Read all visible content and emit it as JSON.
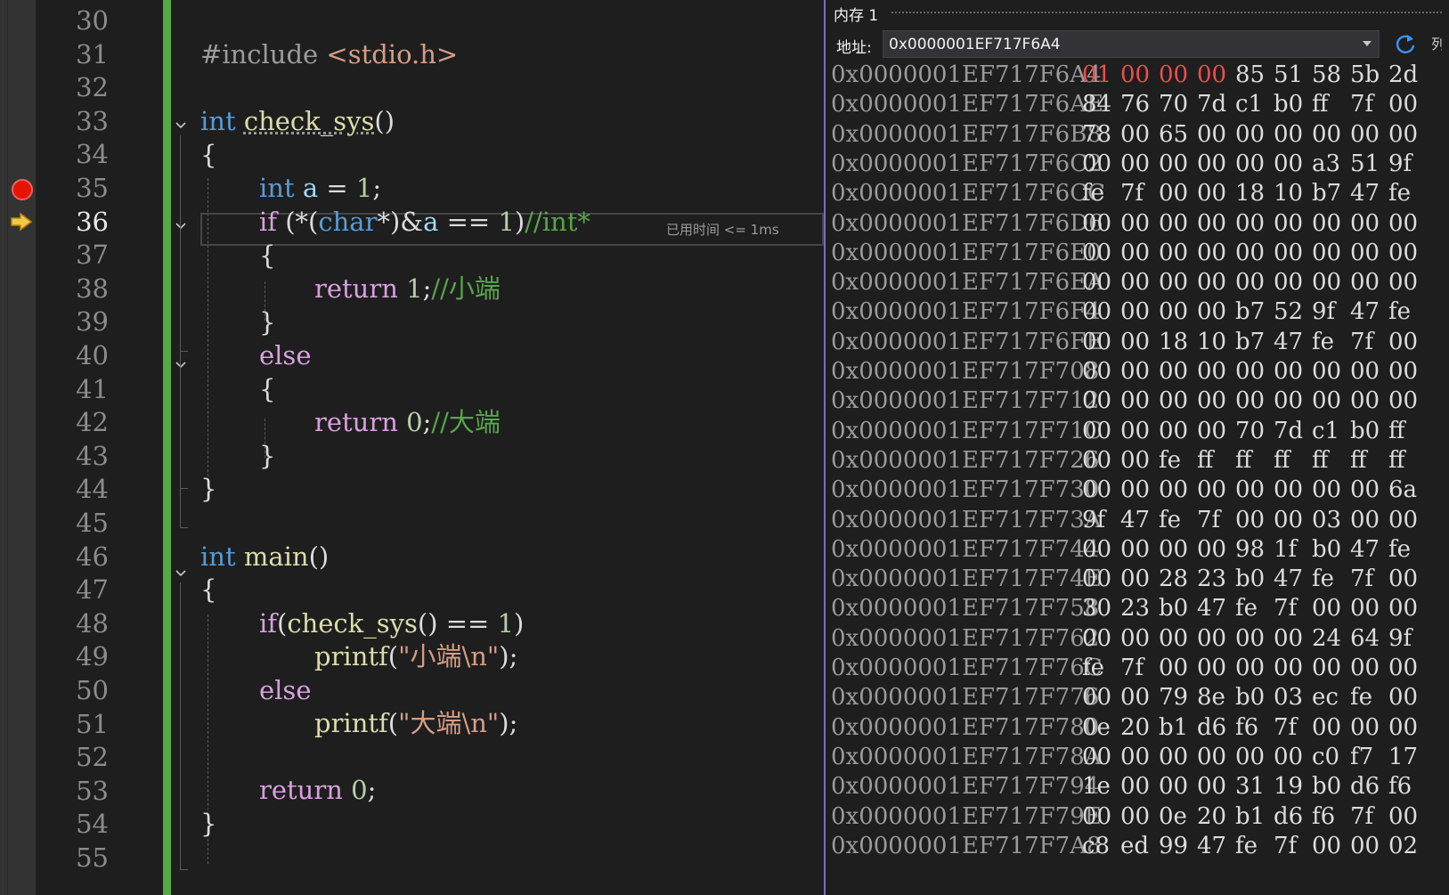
{
  "editor": {
    "line_numbers": [
      "30",
      "31",
      "32",
      "33",
      "34",
      "35",
      "36",
      "37",
      "38",
      "39",
      "40",
      "41",
      "42",
      "43",
      "44",
      "45",
      "46",
      "47",
      "48",
      "49",
      "50",
      "51",
      "52",
      "53",
      "54",
      "55"
    ],
    "current_line": "36",
    "breakpoint_line": "35",
    "elapsed_tip": "已用时间 <= 1ms",
    "code": {
      "l31_a": "#include",
      "l31_b": " <stdio.h>",
      "l33_kw": "int",
      "l33_fn": "check_sys",
      "l33_rest": "()",
      "l34": "{",
      "l35_kw": "int",
      "l35_var": "a",
      "l35_op": " = ",
      "l35_num": "1",
      "l35_end": ";",
      "l36_if": "if",
      "l36_a": " (*(",
      "l36_char": "char",
      "l36_b": "*)&",
      "l36_var": "a",
      "l36_c": " == ",
      "l36_num": "1",
      "l36_d": ")",
      "l36_cmt": "//int*",
      "l37": "{",
      "l38_ret": "return",
      "l38_num": " 1",
      "l38_end": ";",
      "l38_cmt": "//小端",
      "l39": "}",
      "l40_else": "else",
      "l41": "{",
      "l42_ret": "return",
      "l42_num": " 0",
      "l42_end": ";",
      "l42_cmt": "//大端",
      "l43": "}",
      "l44": "}",
      "l46_kw": "int",
      "l46_fn": "main",
      "l46_rest": "()",
      "l47": "{",
      "l48_if": "if",
      "l48_a": "(",
      "l48_fn": "check_sys",
      "l48_b": "() == ",
      "l48_num": "1",
      "l48_c": ")",
      "l49_fn": "printf",
      "l49_a": "(",
      "l49_str": "\"小端\\n\"",
      "l49_b": ");",
      "l50_else": "else",
      "l51_fn": "printf",
      "l51_a": "(",
      "l51_str": "\"大端\\n\"",
      "l51_b": ");",
      "l53_ret": "return",
      "l53_num": " 0",
      "l53_end": ";",
      "l54": "}"
    }
  },
  "memory": {
    "title": "内存 1",
    "address_label": "地址:",
    "address_value": "0x0000001EF717F6A4",
    "extra_button_glyph": "列",
    "rows": [
      {
        "addr": "0x0000001EF717F6A4",
        "bytes": [
          "01",
          "00",
          "00",
          "00",
          "85",
          "51",
          "58",
          "5b",
          "2d"
        ]
      },
      {
        "addr": "0x0000001EF717F6AE",
        "bytes": [
          "84",
          "76",
          "70",
          "7d",
          "c1",
          "b0",
          "ff",
          "7f",
          "00"
        ]
      },
      {
        "addr": "0x0000001EF717F6B8",
        "bytes": [
          "78",
          "00",
          "65",
          "00",
          "00",
          "00",
          "00",
          "00",
          "00"
        ]
      },
      {
        "addr": "0x0000001EF717F6C2",
        "bytes": [
          "00",
          "00",
          "00",
          "00",
          "00",
          "00",
          "a3",
          "51",
          "9f"
        ]
      },
      {
        "addr": "0x0000001EF717F6CC",
        "bytes": [
          "fe",
          "7f",
          "00",
          "00",
          "18",
          "10",
          "b7",
          "47",
          "fe"
        ]
      },
      {
        "addr": "0x0000001EF717F6D6",
        "bytes": [
          "00",
          "00",
          "00",
          "00",
          "00",
          "00",
          "00",
          "00",
          "00"
        ]
      },
      {
        "addr": "0x0000001EF717F6E0",
        "bytes": [
          "00",
          "00",
          "00",
          "00",
          "00",
          "00",
          "00",
          "00",
          "00"
        ]
      },
      {
        "addr": "0x0000001EF717F6EA",
        "bytes": [
          "00",
          "00",
          "00",
          "00",
          "00",
          "00",
          "00",
          "00",
          "00"
        ]
      },
      {
        "addr": "0x0000001EF717F6F4",
        "bytes": [
          "00",
          "00",
          "00",
          "00",
          "b7",
          "52",
          "9f",
          "47",
          "fe"
        ]
      },
      {
        "addr": "0x0000001EF717F6FE",
        "bytes": [
          "00",
          "00",
          "18",
          "10",
          "b7",
          "47",
          "fe",
          "7f",
          "00"
        ]
      },
      {
        "addr": "0x0000001EF717F708",
        "bytes": [
          "00",
          "00",
          "00",
          "00",
          "00",
          "00",
          "00",
          "00",
          "00"
        ]
      },
      {
        "addr": "0x0000001EF717F712",
        "bytes": [
          "00",
          "00",
          "00",
          "00",
          "00",
          "00",
          "00",
          "00",
          "00"
        ]
      },
      {
        "addr": "0x0000001EF717F71C",
        "bytes": [
          "00",
          "00",
          "00",
          "00",
          "70",
          "7d",
          "c1",
          "b0",
          "ff"
        ]
      },
      {
        "addr": "0x0000001EF717F726",
        "bytes": [
          "00",
          "00",
          "fe",
          "ff",
          "ff",
          "ff",
          "ff",
          "ff",
          "ff"
        ]
      },
      {
        "addr": "0x0000001EF717F730",
        "bytes": [
          "00",
          "00",
          "00",
          "00",
          "00",
          "00",
          "00",
          "00",
          "6a"
        ]
      },
      {
        "addr": "0x0000001EF717F73A",
        "bytes": [
          "9f",
          "47",
          "fe",
          "7f",
          "00",
          "00",
          "03",
          "00",
          "00"
        ]
      },
      {
        "addr": "0x0000001EF717F744",
        "bytes": [
          "00",
          "00",
          "00",
          "00",
          "98",
          "1f",
          "b0",
          "47",
          "fe"
        ]
      },
      {
        "addr": "0x0000001EF717F74E",
        "bytes": [
          "00",
          "00",
          "28",
          "23",
          "b0",
          "47",
          "fe",
          "7f",
          "00"
        ]
      },
      {
        "addr": "0x0000001EF717F758",
        "bytes": [
          "30",
          "23",
          "b0",
          "47",
          "fe",
          "7f",
          "00",
          "00",
          "00"
        ]
      },
      {
        "addr": "0x0000001EF717F762",
        "bytes": [
          "00",
          "00",
          "00",
          "00",
          "00",
          "00",
          "24",
          "64",
          "9f"
        ]
      },
      {
        "addr": "0x0000001EF717F76C",
        "bytes": [
          "fe",
          "7f",
          "00",
          "00",
          "00",
          "00",
          "00",
          "00",
          "00"
        ]
      },
      {
        "addr": "0x0000001EF717F776",
        "bytes": [
          "00",
          "00",
          "79",
          "8e",
          "b0",
          "03",
          "ec",
          "fe",
          "00"
        ]
      },
      {
        "addr": "0x0000001EF717F780",
        "bytes": [
          "0e",
          "20",
          "b1",
          "d6",
          "f6",
          "7f",
          "00",
          "00",
          "00"
        ]
      },
      {
        "addr": "0x0000001EF717F78A",
        "bytes": [
          "00",
          "00",
          "00",
          "00",
          "00",
          "00",
          "c0",
          "f7",
          "17"
        ]
      },
      {
        "addr": "0x0000001EF717F794",
        "bytes": [
          "1e",
          "00",
          "00",
          "00",
          "31",
          "19",
          "b0",
          "d6",
          "f6"
        ]
      },
      {
        "addr": "0x0000001EF717F79E",
        "bytes": [
          "00",
          "00",
          "0e",
          "20",
          "b1",
          "d6",
          "f6",
          "7f",
          "00"
        ]
      },
      {
        "addr": "0x0000001EF717F7A8",
        "bytes": [
          "c8",
          "ed",
          "99",
          "47",
          "fe",
          "7f",
          "00",
          "00",
          "02"
        ]
      }
    ],
    "changed_bytes_in_first_row": 4
  }
}
